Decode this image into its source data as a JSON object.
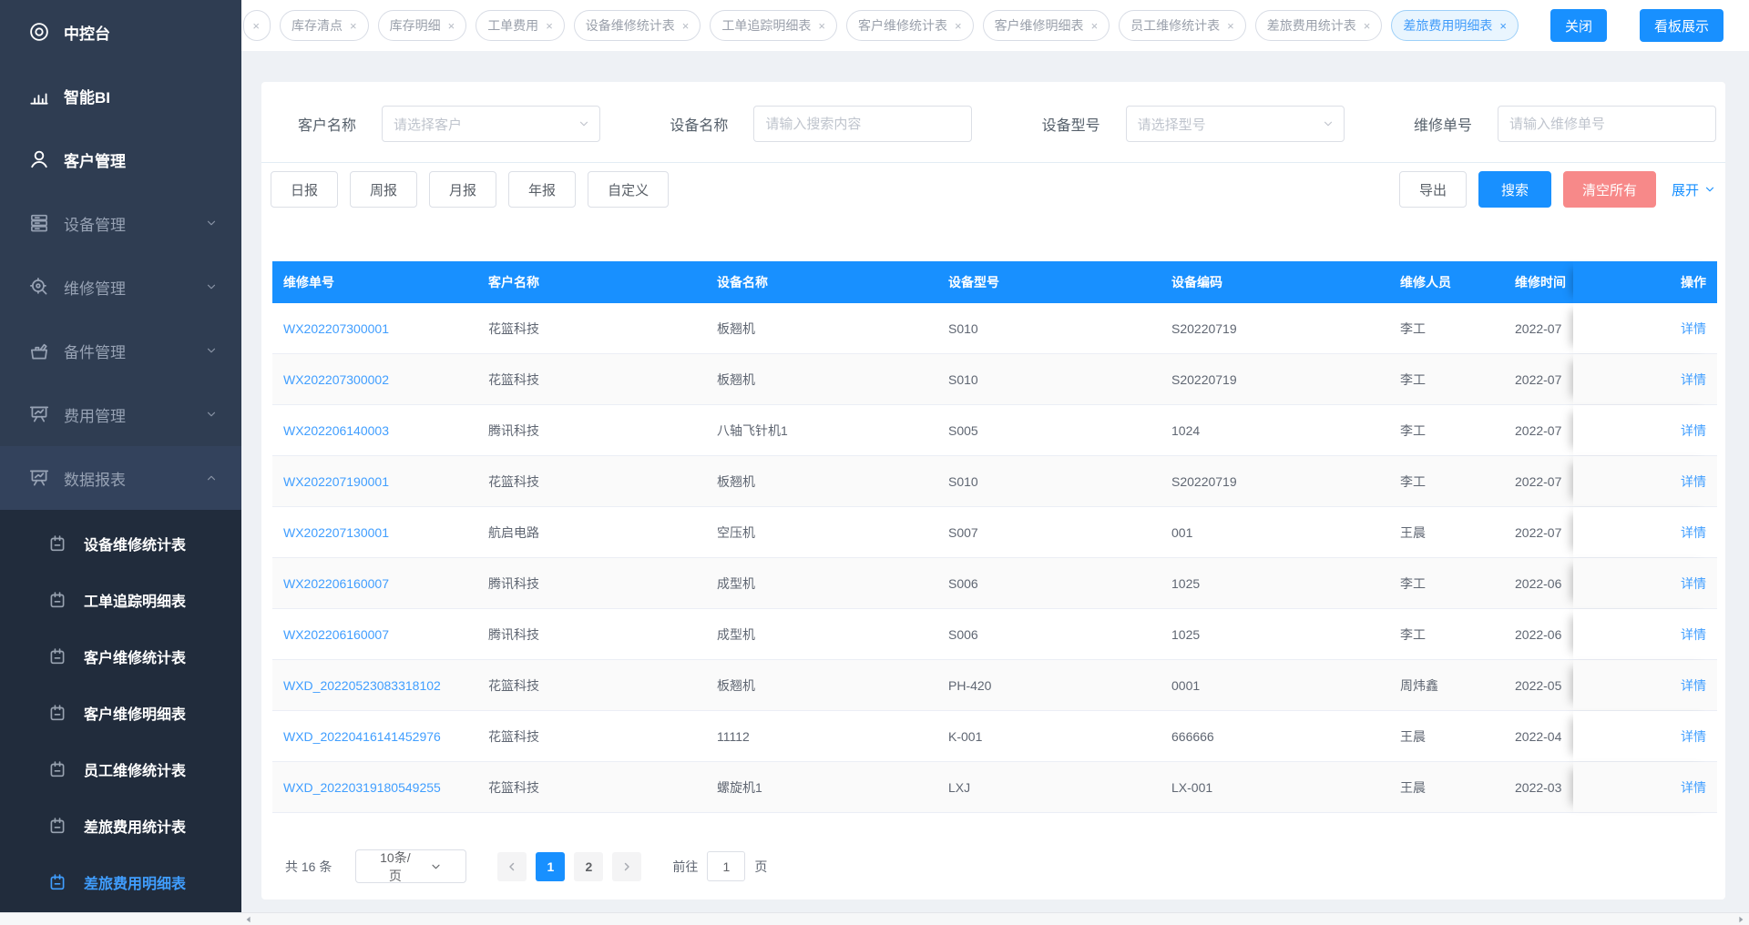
{
  "sidebar": {
    "menu": [
      {
        "id": "console",
        "label": "中控台",
        "icon": "dashboard-icon",
        "emphasis": true
      },
      {
        "id": "bi",
        "label": "智能BI",
        "icon": "chart-icon",
        "emphasis": true
      },
      {
        "id": "customer",
        "label": "客户管理",
        "icon": "users-icon",
        "emphasis": true
      },
      {
        "id": "equipment",
        "label": "设备管理",
        "icon": "equipment-icon",
        "chevron": "down"
      },
      {
        "id": "repair",
        "label": "维修管理",
        "icon": "repair-icon",
        "chevron": "down"
      },
      {
        "id": "spare",
        "label": "备件管理",
        "icon": "toolbox-icon",
        "chevron": "down"
      },
      {
        "id": "expense",
        "label": "费用管理",
        "icon": "board-icon",
        "chevron": "down"
      },
      {
        "id": "report",
        "label": "数据报表",
        "icon": "board-icon",
        "chevron": "up",
        "expanded": true
      }
    ],
    "submenu": [
      {
        "id": "device-repair-stats",
        "label": "设备维修统计表",
        "icon": "notebook-icon"
      },
      {
        "id": "workorder-trace-detail",
        "label": "工单追踪明细表",
        "icon": "notebook-icon"
      },
      {
        "id": "customer-repair-stats",
        "label": "客户维修统计表",
        "icon": "notebook-icon"
      },
      {
        "id": "customer-repair-detail",
        "label": "客户维修明细表",
        "icon": "notebook-icon"
      },
      {
        "id": "staff-repair-stats",
        "label": "员工维修统计表",
        "icon": "notebook-icon"
      },
      {
        "id": "travel-expense-stats",
        "label": "差旅费用统计表",
        "icon": "notebook-icon"
      },
      {
        "id": "travel-expense-detail",
        "label": "差旅费用明细表",
        "icon": "notebook-icon"
      }
    ],
    "active_submenu": "差旅费用明细表"
  },
  "tabbar": {
    "tabs": [
      {
        "label": "",
        "clipped": true
      },
      {
        "label": "库存清点"
      },
      {
        "label": "库存明细"
      },
      {
        "label": "工单费用"
      },
      {
        "label": "设备维修统计表"
      },
      {
        "label": "工单追踪明细表"
      },
      {
        "label": "客户维修统计表"
      },
      {
        "label": "客户维修明细表"
      },
      {
        "label": "员工维修统计表"
      },
      {
        "label": "差旅费用统计表"
      },
      {
        "label": "差旅费用明细表"
      }
    ],
    "active_tab": "差旅费用明细表",
    "close_button": "关闭",
    "board_button": "看板展示"
  },
  "filters": {
    "customer": {
      "label": "客户名称",
      "placeholder": "请选择客户"
    },
    "device": {
      "label": "设备名称",
      "placeholder": "请输入搜索内容"
    },
    "model": {
      "label": "设备型号",
      "placeholder": "请选择型号"
    },
    "order": {
      "label": "维修单号",
      "placeholder": "请输入维修单号"
    }
  },
  "report_buttons": [
    "日报",
    "周报",
    "月报",
    "年报",
    "自定义"
  ],
  "actions": {
    "export": "导出",
    "search": "搜索",
    "clear": "清空所有",
    "expand": "展开"
  },
  "table": {
    "columns": [
      "维修单号",
      "客户名称",
      "设备名称",
      "设备型号",
      "设备编码",
      "维修人员",
      "维修时间",
      "操作"
    ],
    "detail_label": "详情",
    "rows": [
      {
        "order": "WX202207300001",
        "customer": "花篮科技",
        "device": "板翘机",
        "model": "S010",
        "code": "S20220719",
        "staff": "李工",
        "time": "2022-07"
      },
      {
        "order": "WX202207300002",
        "customer": "花篮科技",
        "device": "板翘机",
        "model": "S010",
        "code": "S20220719",
        "staff": "李工",
        "time": "2022-07"
      },
      {
        "order": "WX202206140003",
        "customer": "腾讯科技",
        "device": "八轴飞针机1",
        "model": "S005",
        "code": "1024",
        "staff": "李工",
        "time": "2022-07"
      },
      {
        "order": "WX202207190001",
        "customer": "花篮科技",
        "device": "板翘机",
        "model": "S010",
        "code": "S20220719",
        "staff": "李工",
        "time": "2022-07"
      },
      {
        "order": "WX202207130001",
        "customer": "航启电路",
        "device": "空压机",
        "model": "S007",
        "code": "001",
        "staff": "王晨",
        "time": "2022-07"
      },
      {
        "order": "WX202206160007",
        "customer": "腾讯科技",
        "device": "成型机",
        "model": "S006",
        "code": "1025",
        "staff": "李工",
        "time": "2022-06"
      },
      {
        "order": "WX202206160007",
        "customer": "腾讯科技",
        "device": "成型机",
        "model": "S006",
        "code": "1025",
        "staff": "李工",
        "time": "2022-06"
      },
      {
        "order": "WXD_20220523083318102",
        "customer": "花篮科技",
        "device": "板翘机",
        "model": "PH-420",
        "code": "0001",
        "staff": "周炜鑫",
        "time": "2022-05"
      },
      {
        "order": "WXD_20220416141452976",
        "customer": "花篮科技",
        "device": "11112",
        "model": "K-001",
        "code": "666666",
        "staff": "王晨",
        "time": "2022-04"
      },
      {
        "order": "WXD_20220319180549255",
        "customer": "花篮科技",
        "device": "螺旋机1",
        "model": "LXJ",
        "code": "LX-001",
        "staff": "王晨",
        "time": "2022-03"
      }
    ]
  },
  "pagination": {
    "total_text": "共 16 条",
    "page_size": "10条/页",
    "pages": [
      "1",
      "2"
    ],
    "active_page": "1",
    "goto_label": "前往",
    "goto_value": "1",
    "page_suffix": "页"
  }
}
